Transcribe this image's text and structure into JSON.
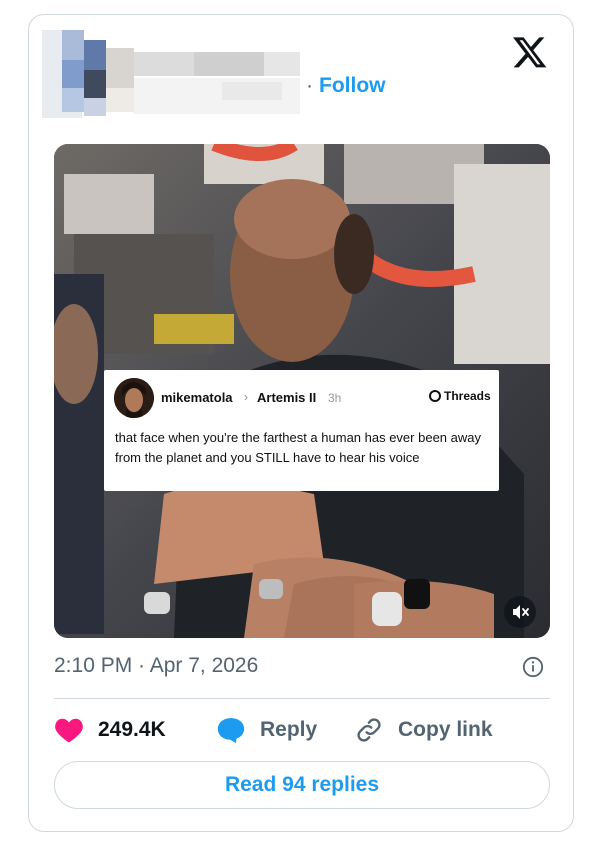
{
  "header": {
    "follow_label": "Follow",
    "separator": "·"
  },
  "media_overlay": {
    "handle": "mikematola",
    "separator": "›",
    "community": "Artemis II",
    "time": "3h",
    "source_label": "Threads",
    "text": "that face when you're the farthest a human has ever been away from the planet and you STILL have to hear his voice"
  },
  "post": {
    "timestamp": "2:10 PM · Apr 7, 2026"
  },
  "actions": {
    "like_count": "249.4K",
    "reply_label": "Reply",
    "copy_label": "Copy link"
  },
  "footer": {
    "read_replies_label": "Read 94 replies"
  },
  "colors": {
    "accent": "#1d9bf0",
    "like": "#f91880",
    "muted": "#536471",
    "border": "#cfd9de"
  },
  "icons": {
    "logo": "x-logo-icon",
    "like": "heart-icon",
    "reply": "speech-bubble-icon",
    "copy": "link-icon",
    "info": "info-icon",
    "mute": "muted-speaker-icon"
  }
}
